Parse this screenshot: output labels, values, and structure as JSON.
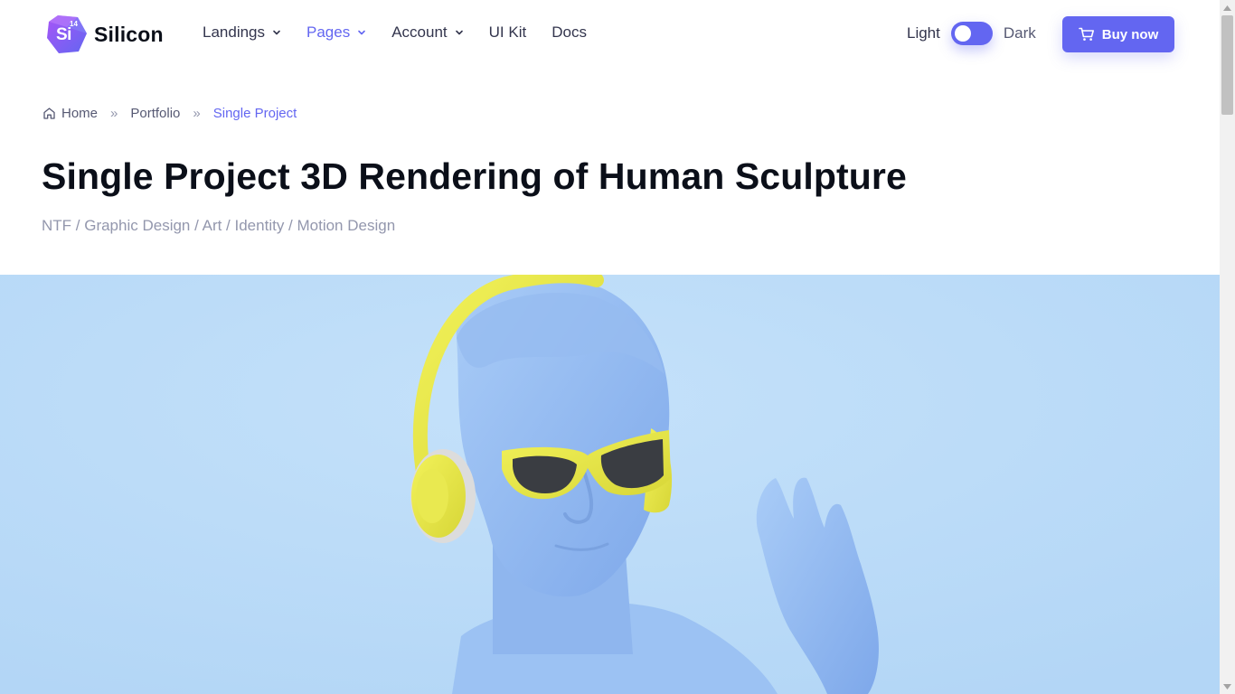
{
  "brand": {
    "name": "Silicon",
    "symbol": "Si",
    "number": "14",
    "accent": "#6366f1"
  },
  "nav": {
    "items": [
      {
        "label": "Landings",
        "has_dropdown": true,
        "active": false
      },
      {
        "label": "Pages",
        "has_dropdown": true,
        "active": true
      },
      {
        "label": "Account",
        "has_dropdown": true,
        "active": false
      },
      {
        "label": "UI Kit",
        "has_dropdown": false,
        "active": false
      },
      {
        "label": "Docs",
        "has_dropdown": false,
        "active": false
      }
    ]
  },
  "theme": {
    "light_label": "Light",
    "dark_label": "Dark",
    "mode": "light"
  },
  "buy": {
    "label": "Buy now",
    "icon": "cart-icon"
  },
  "breadcrumb": {
    "items": [
      {
        "label": "Home",
        "icon": "home-icon"
      },
      {
        "label": "Portfolio"
      },
      {
        "label": "Single Project",
        "current": true
      }
    ],
    "separator": "»"
  },
  "page": {
    "title": "Single Project 3D Rendering of Human Sculpture",
    "tags": "NTF / Graphic Design / Art / Identity / Motion Design"
  },
  "hero": {
    "background": "#b9dbf8",
    "subject_colors": {
      "sculpture": "#8fb8f0",
      "accessories": "#e8e84a",
      "lenses": "#3a3d42"
    }
  }
}
